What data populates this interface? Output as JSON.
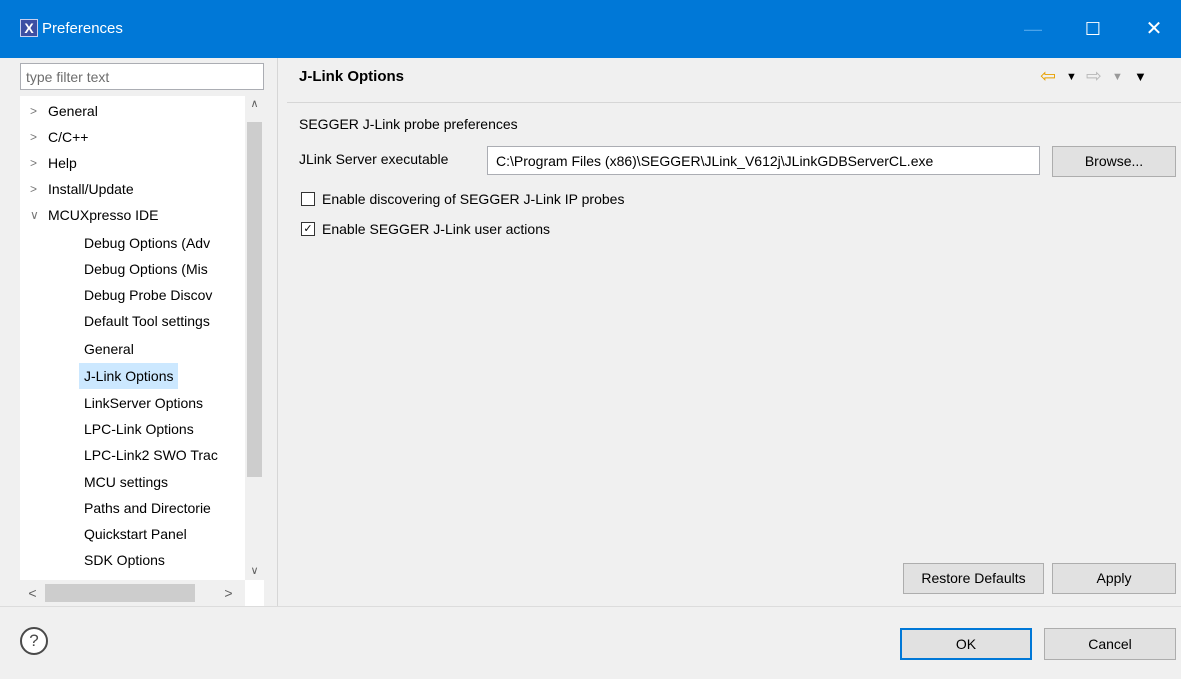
{
  "window": {
    "title": "Preferences",
    "app_icon": "X",
    "minimize": "—",
    "maximize": "☐",
    "close": "✕"
  },
  "filter": {
    "placeholder": "type filter text",
    "value": ""
  },
  "tree": {
    "top_level": [
      {
        "label": "General",
        "expanded": false
      },
      {
        "label": "C/C++",
        "expanded": false
      },
      {
        "label": "Help",
        "expanded": false
      },
      {
        "label": "Install/Update",
        "expanded": false
      },
      {
        "label": "MCUXpresso IDE",
        "expanded": true
      }
    ],
    "children": [
      "Debug Options (Adv",
      "Debug Options (Mis",
      "Debug Probe Discov",
      "Default Tool settings",
      "General",
      "J-Link Options",
      "LinkServer Options",
      "LPC-Link Options",
      "LPC-Link2 SWO Trac",
      "MCU settings",
      "Paths and Directorie",
      "Quickstart Panel",
      "SDK Options"
    ],
    "selected": "J-Link Options"
  },
  "page": {
    "title": "J-Link Options",
    "description": "SEGGER J-Link probe preferences",
    "exe_label": "JLink Server executable",
    "exe_value": "C:\\Program Files (x86)\\SEGGER\\JLink_V612j\\JLinkGDBServerCL.exe",
    "browse_label": "Browse...",
    "options": [
      {
        "label": "Enable discovering of SEGGER J-Link IP probes",
        "checked": false
      },
      {
        "label": "Enable SEGGER J-Link user actions",
        "checked": true
      }
    ],
    "restore_label": "Restore Defaults",
    "apply_label": "Apply"
  },
  "footer": {
    "help": "?",
    "ok_label": "OK",
    "cancel_label": "Cancel"
  },
  "colors": {
    "title_bar": "#0078d7",
    "selection": "#cce8ff",
    "nav_back": "#e8a000"
  }
}
